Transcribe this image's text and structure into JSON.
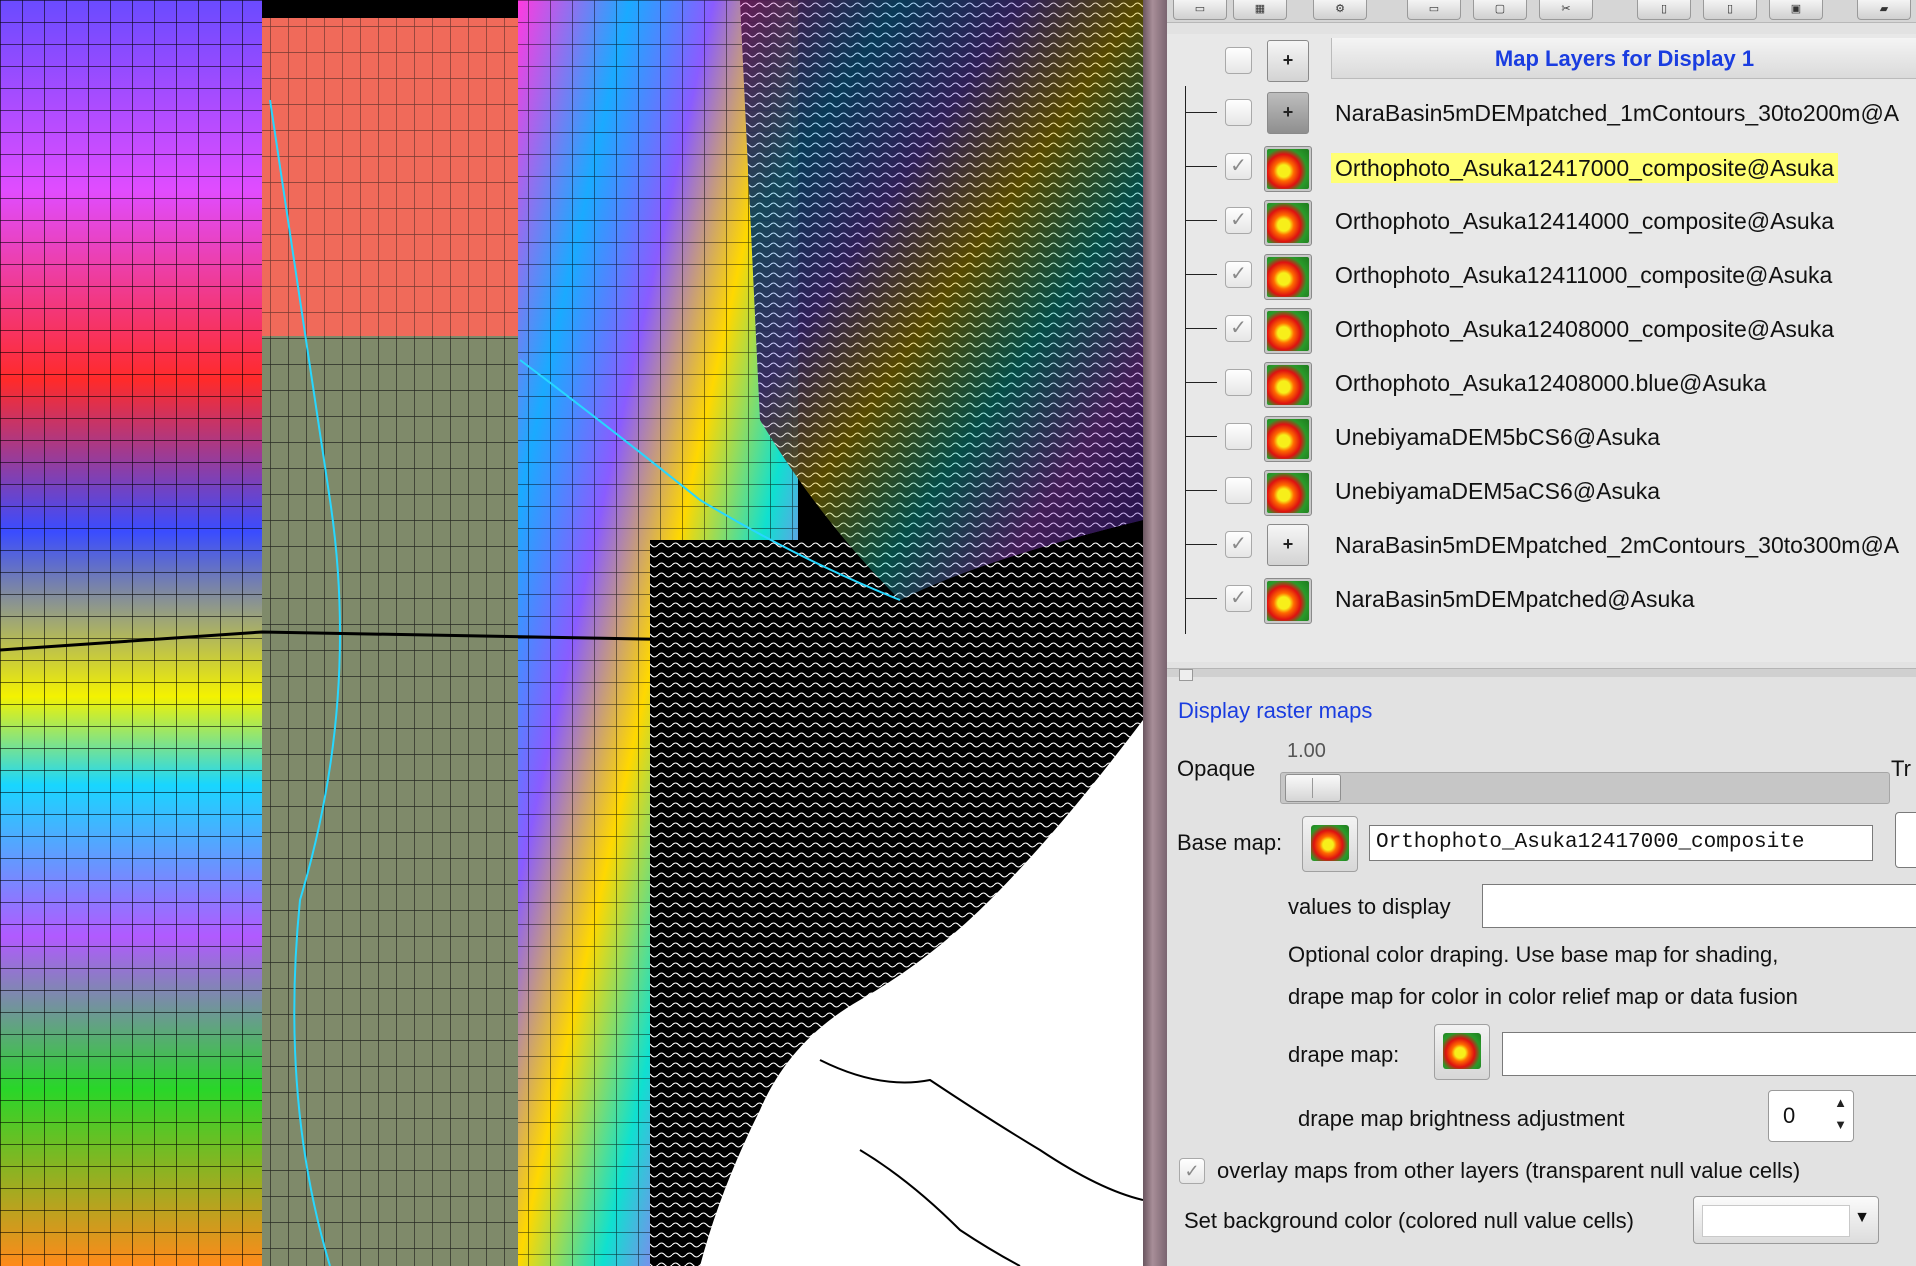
{
  "tree": {
    "header": "Map Layers for Display 1",
    "layers": [
      {
        "label": "NaraBasin5mDEMpatched_1mContours_30to200m@A",
        "checked": false,
        "type": "vector-dark",
        "selected": false
      },
      {
        "label": "Orthophoto_Asuka12417000_composite@Asuka",
        "checked": true,
        "type": "raster",
        "selected": true
      },
      {
        "label": "Orthophoto_Asuka12414000_composite@Asuka",
        "checked": true,
        "type": "raster",
        "selected": false
      },
      {
        "label": "Orthophoto_Asuka12411000_composite@Asuka",
        "checked": true,
        "type": "raster",
        "selected": false
      },
      {
        "label": "Orthophoto_Asuka12408000_composite@Asuka",
        "checked": true,
        "type": "raster",
        "selected": false
      },
      {
        "label": "Orthophoto_Asuka12408000.blue@Asuka",
        "checked": false,
        "type": "raster",
        "selected": false
      },
      {
        "label": "UnebiyamaDEM5bCS6@Asuka",
        "checked": false,
        "type": "raster",
        "selected": false
      },
      {
        "label": "UnebiyamaDEM5aCS6@Asuka",
        "checked": false,
        "type": "raster",
        "selected": false
      },
      {
        "label": "NaraBasin5mDEMpatched_2mContours_30to300m@A",
        "checked": true,
        "type": "vector",
        "selected": false
      },
      {
        "label": "NaraBasin5mDEMpatched@Asuka",
        "checked": true,
        "type": "raster",
        "selected": false
      }
    ]
  },
  "options": {
    "section_title": "Display raster maps",
    "opacity_label": "Opaque",
    "opacity_value": "1.00",
    "opacity_fraction": 1.0,
    "transparent_label": "Tr",
    "base_map_label": "Base map:",
    "base_map_value": "Orthophoto_Asuka12417000_composite",
    "values_label": "values to display",
    "values_value": "",
    "drape_help_1": "Optional color draping. Use base map for shading,",
    "drape_help_2": "drape map for color in color relief map or data fusion",
    "drape_label": "drape map:",
    "drape_value": "",
    "brightness_label": "drape map brightness adjustment",
    "brightness_value": "0",
    "overlay_label": "overlay maps from other layers (transparent null value cells)",
    "overlay_checked": true,
    "bgcolor_label": "Set background color (colored null value cells)"
  },
  "colors": {
    "selected_highlight": "#ffff74",
    "link_blue": "#1a3de0"
  }
}
